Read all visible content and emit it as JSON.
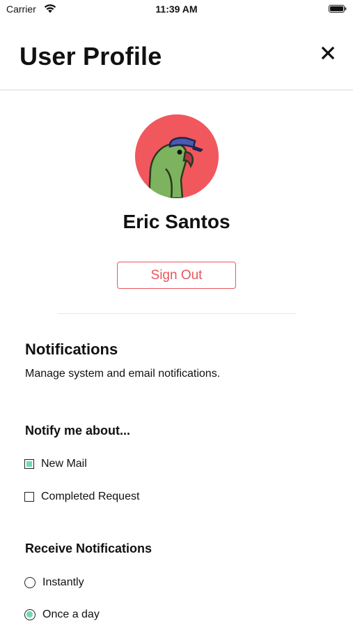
{
  "status_bar": {
    "carrier": "Carrier",
    "time": "11:39 AM"
  },
  "header": {
    "title": "User Profile",
    "close_icon": "close-icon"
  },
  "profile": {
    "name": "Eric Santos",
    "avatar_icon": "parrot-avatar",
    "sign_out_label": "Sign Out"
  },
  "notifications": {
    "title": "Notifications",
    "description": "Manage system and email notifications.",
    "notify_title": "Notify me about...",
    "notify_options": [
      {
        "label": "New Mail",
        "checked": true
      },
      {
        "label": "Completed Request",
        "checked": false
      }
    ],
    "receive_title": "Receive Notifications",
    "receive_options": [
      {
        "label": "Instantly",
        "selected": false
      },
      {
        "label": "Once a day",
        "selected": true
      }
    ]
  },
  "colors": {
    "accent": "#e8575c",
    "check": "#6fdcaf",
    "avatar_bg": "#f0585d"
  }
}
